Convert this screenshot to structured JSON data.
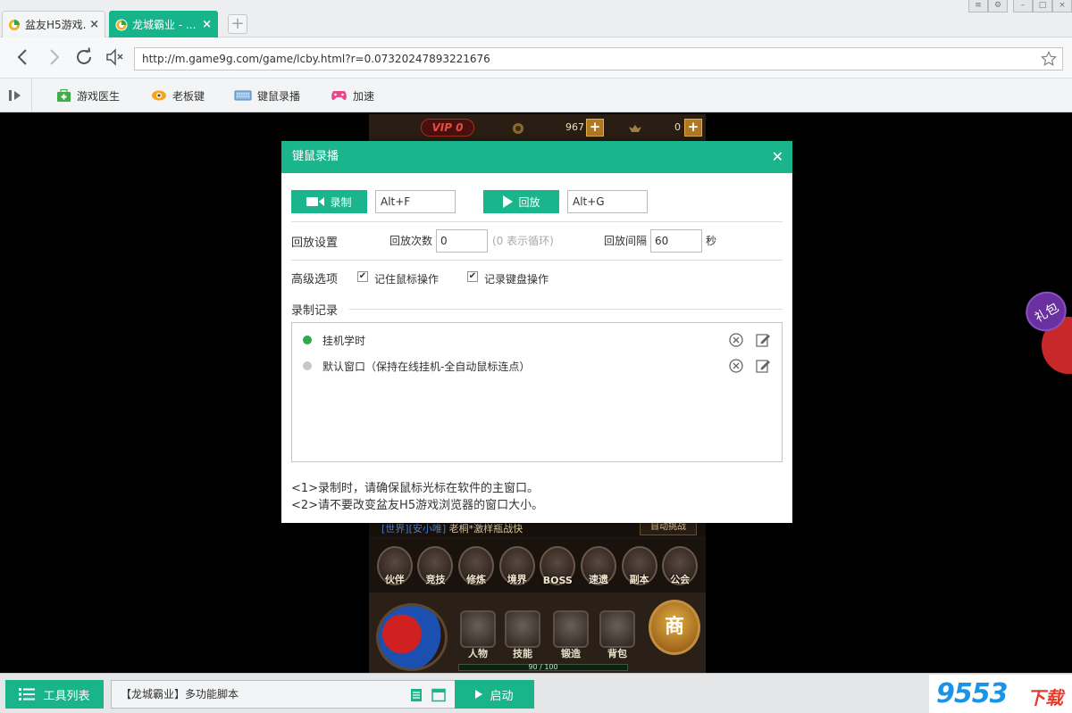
{
  "tabs": [
    {
      "title": "盆友H5游戏...",
      "active": false
    },
    {
      "title": "龙城霸业 - ...",
      "active": true
    }
  ],
  "address": {
    "url": "http://m.game9g.com/game/lcby.html?r=0.07320247893221676"
  },
  "toolbar": {
    "items": [
      {
        "label": "游戏医生",
        "icon": "medkit-icon"
      },
      {
        "label": "老板键",
        "icon": "eye-icon"
      },
      {
        "label": "键鼠录播",
        "icon": "keyboard-icon"
      },
      {
        "label": "加速",
        "icon": "gamepad-icon"
      }
    ]
  },
  "game": {
    "vip": "VIP 0",
    "gold": "967",
    "ingots": "0",
    "chat": {
      "tag1": "[世界]",
      "tag2": "[安小唯]",
      "msg": " 老桐*激样瓶战快"
    },
    "auto_challenge": "自动挑战",
    "skills": [
      "伙伴",
      "竞技",
      "修炼",
      "境界",
      "BOSS",
      "速遗",
      "副本",
      "公会"
    ],
    "hud_buttons": [
      "人物",
      "技能",
      "锻造",
      "背包"
    ],
    "shop": "商",
    "exp": "90 / 100"
  },
  "side": {
    "gift": "礼包"
  },
  "dialog": {
    "title": "键鼠录播",
    "record_label": "录制",
    "record_hotkey": "Alt+F",
    "play_label": "回放",
    "play_hotkey": "Alt+G",
    "playback_section": "回放设置",
    "count_label": "回放次数",
    "count_value": "0",
    "count_hint": "(0 表示循环)",
    "interval_label": "回放间隔",
    "interval_value": "60",
    "interval_unit": "秒",
    "advanced_section": "高级选项",
    "opt_mouse": "记住鼠标操作",
    "opt_mouse_checked": true,
    "opt_keyboard": "记录键盘操作",
    "opt_keyboard_checked": true,
    "records_section": "录制记录",
    "records": [
      {
        "name": "挂机学时",
        "active": true
      },
      {
        "name": "默认窗口（保持在线挂机-全自动鼠标连点）",
        "active": false
      }
    ],
    "notes": [
      "<1>录制时，请确保鼠标光标在软件的主窗口。",
      "<2>请不要改变盆友H5游戏浏览器的窗口大小。"
    ]
  },
  "bottom": {
    "tool_list": "工具列表",
    "script": "【龙城霸业】多功能脚本",
    "start": "启动"
  },
  "watermark": {
    "text": "9553",
    "sub": "下载"
  },
  "colors": {
    "accent": "#1ab58c",
    "active_dot": "#2ea84a",
    "inactive_dot": "#c8c8c8"
  }
}
